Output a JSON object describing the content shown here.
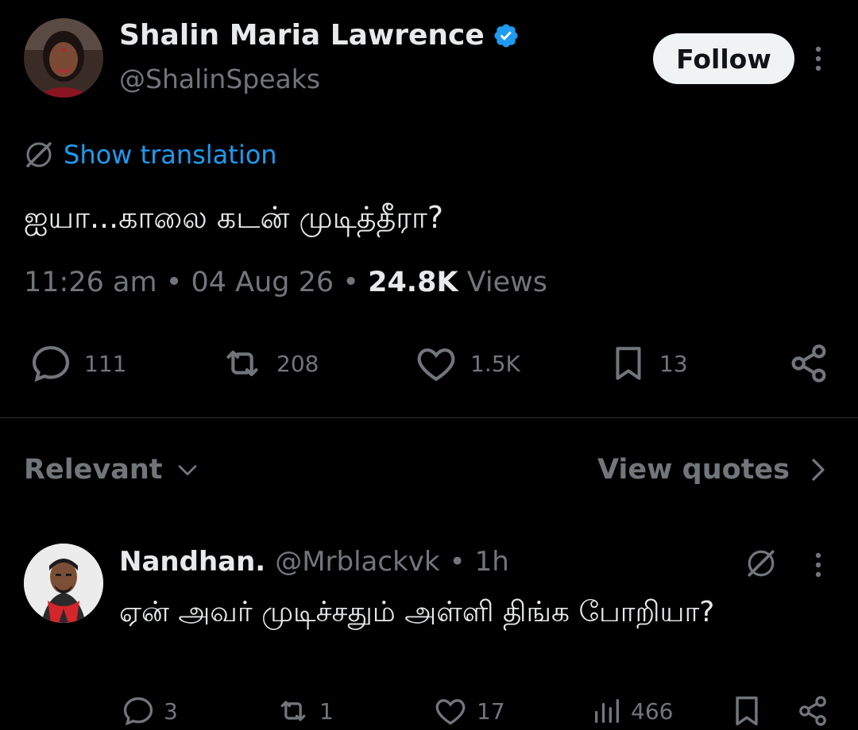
{
  "tweet": {
    "author_name": "Shalin Maria Lawrence",
    "author_handle": "@ShalinSpeaks",
    "follow_label": "Follow",
    "translate_label": "Show translation",
    "text": "ஐயா...காலை கடன் முடித்தீரா?",
    "time": "11:26 am",
    "date": "04 Aug 26",
    "views_count": "24.8K",
    "views_label": "Views",
    "separator": "•",
    "stats": {
      "replies": "111",
      "reposts": "208",
      "likes": "1.5K",
      "bookmarks": "13"
    }
  },
  "sort": {
    "label": "Relevant",
    "quotes_label": "View quotes"
  },
  "reply": {
    "name": "Nandhan.",
    "handle": "@Mrblackvk",
    "separator": "•",
    "time": "1h",
    "text": "ஏன் அவர் முடிச்சதும் அள்ளி திங்க போறியா?",
    "stats": {
      "replies": "3",
      "reposts": "1",
      "likes": "17",
      "views": "466"
    }
  },
  "colors": {
    "background": "#000000",
    "text": "#e7e9ea",
    "muted": "#71767b",
    "accent": "#1d9bf0",
    "verified": "#1d9bf0"
  }
}
